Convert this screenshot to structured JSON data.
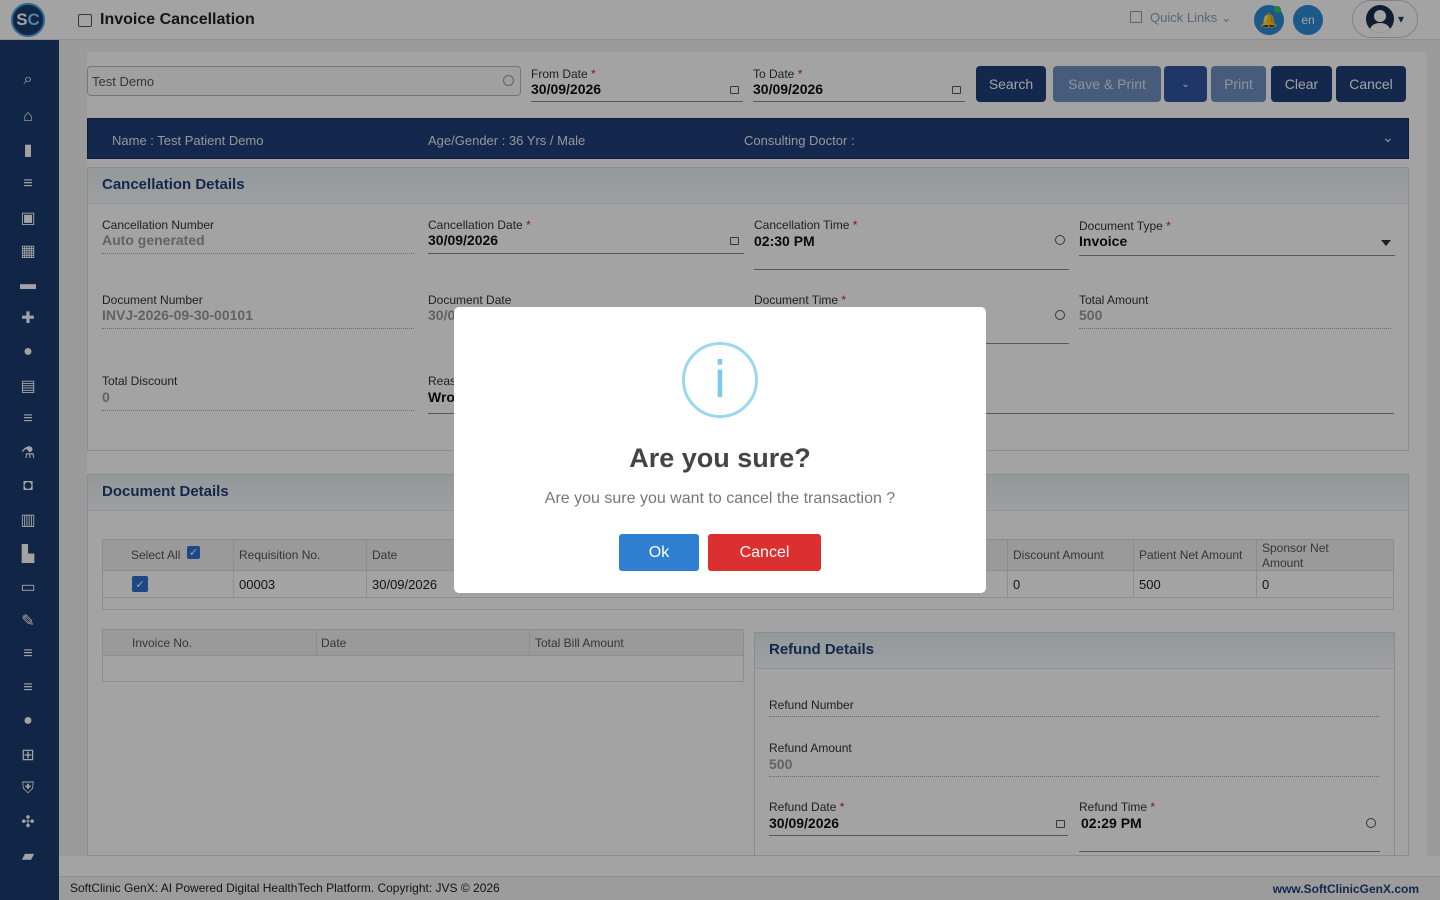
{
  "app": {
    "logo_left": "S",
    "logo_right": "C",
    "page_title": "Invoice Cancellation"
  },
  "topbar": {
    "quick_links": "Quick Links",
    "lang": "en"
  },
  "search": {
    "value": "Test Demo"
  },
  "dates": {
    "from_label": "From Date",
    "from_value": "30/09/2026",
    "to_label": "To Date",
    "to_value": "30/09/2026"
  },
  "toolbar": {
    "search": "Search",
    "save_print": "Save & Print",
    "print": "Print",
    "clear": "Clear",
    "cancel": "Cancel"
  },
  "patient": {
    "name": "Name :  Test Patient Demo",
    "age_gender": "Age/Gender :  36 Yrs / Male",
    "doctor": "Consulting Doctor :"
  },
  "cancellation": {
    "title": "Cancellation Details",
    "number_label": "Cancellation Number",
    "number_value": "Auto generated",
    "date_label": "Cancellation Date",
    "date_value": "30/09/2026",
    "time_label": "Cancellation Time",
    "time_value": "02:30 PM",
    "doctype_label": "Document Type",
    "doctype_value": "Invoice",
    "docnum_label": "Document Number",
    "docnum_value": "INVJ-2026-09-30-00101",
    "docdate_label": "Document Date",
    "docdate_value": "30/0",
    "doctime_label": "Document Time",
    "total_label": "Total Amount",
    "total_value": "500",
    "discount_label": "Total Discount",
    "discount_value": "0",
    "reason_label": "Reas",
    "reason_value": "Wro"
  },
  "document": {
    "title": "Document Details",
    "select_all": "Select All",
    "headers": [
      "Requisition No.",
      "Date",
      "Discount Amount",
      "Patient Net Amount",
      "Sponsor Net",
      "Amount"
    ],
    "row": {
      "req": "00003",
      "date": "30/09/2026",
      "discount": "0",
      "patient_net": "500",
      "sponsor_net": "0"
    }
  },
  "invoice_table": {
    "headers": [
      "Invoice No.",
      "Date",
      "Total Bill Amount"
    ]
  },
  "refund": {
    "title": "Refund Details",
    "number_label": "Refund Number",
    "amount_label": "Refund Amount",
    "amount_value": "500",
    "date_label": "Refund Date",
    "date_value": "30/09/2026",
    "time_label": "Refund Time",
    "time_value": "02:29 PM"
  },
  "modal": {
    "icon": "i",
    "title": "Are you sure?",
    "text": "Are you sure you want to cancel the transaction ?",
    "ok": "Ok",
    "cancel": "Cancel"
  },
  "footer": {
    "left": "SoftClinic GenX: AI Powered Digital HealthTech Platform. Copyright: JVS © 2026",
    "right": "www.SoftClinicGenX.com"
  },
  "colors": {
    "primary": "#1e3f78",
    "ok_button": "#2f80d3",
    "cancel_button": "#dc2f2f"
  },
  "sidebar_icons": [
    "search-icon",
    "home-icon",
    "chart-icon",
    "menu-icon",
    "badge-icon",
    "calendar-icon",
    "bed-icon",
    "medical-plus-icon",
    "user-icon",
    "document-icon",
    "list-icon",
    "lab-icon",
    "pharmacy-icon",
    "book-icon",
    "building-icon",
    "devices-icon",
    "wrench-icon",
    "menu-icon",
    "menu-icon",
    "blood-drop-icon",
    "add-box-icon",
    "shield-icon",
    "network-icon",
    "folder-icon"
  ]
}
